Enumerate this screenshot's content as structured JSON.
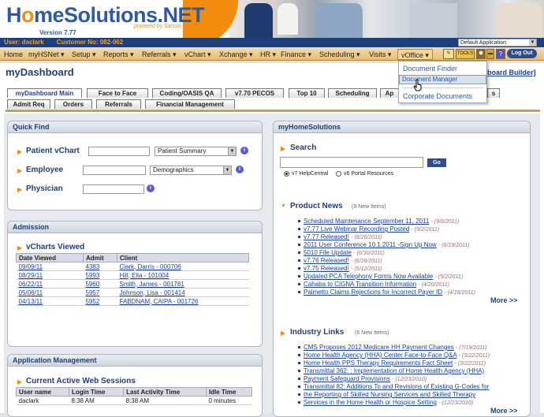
{
  "header": {
    "brand": "HomeSolutions.NET",
    "brand_left": "H",
    "brand_o": "o",
    "brand_rest": "meSolutions.NET",
    "version": "Version 7.77",
    "powered_by": "powered by Sansio"
  },
  "userbar": {
    "user": "User: daclark",
    "customer": "Customer No: 082-062"
  },
  "application": {
    "label": "Application",
    "value": "Default Application"
  },
  "nav": [
    "Home",
    "myHSNet ▾",
    "Setup ▾",
    "Reports ▾",
    "Referrals ▾",
    "vChart ▾",
    "Xchange ▾",
    "HR ▾",
    "Finance ▾",
    "Scheduling ▾",
    "Visits ▾",
    "vOffice ▾"
  ],
  "toolbar": {
    "tool1": "TOOLS",
    "logout": "Log Out",
    "help": "?"
  },
  "dropdown": {
    "items": [
      "Document Finder",
      "Document Manager",
      "Corporate Documents"
    ],
    "selected": 1
  },
  "page": {
    "title": "myDashboard",
    "builder": "board Builder]"
  },
  "tabs_row1": [
    "myDashboard Main",
    "Face to Face",
    "Coding/OASIS QA",
    "v7.70 PECOS",
    "Top 10",
    "Scheduling",
    "Ap",
    "s"
  ],
  "tabs_row2": [
    "Admit Req",
    "Orders",
    "Referrals",
    "Financial Management"
  ],
  "quick_find": {
    "title": "Quick Find",
    "patient_label": "Patient vChart",
    "patient_select": "Patient Summary",
    "employee_label": "Employee",
    "employee_select": "Demographics",
    "physician_label": "Physician"
  },
  "admission": {
    "title": "Admission",
    "subtitle": "vCharts Viewed",
    "columns": [
      "Date Viewed",
      "Admit",
      "Client"
    ],
    "rows": [
      [
        "09/09/11",
        "4383",
        "Clark, Darris - 000706"
      ],
      [
        "08/29/11",
        "5993",
        "Hill, Ella - 101004"
      ],
      [
        "06/22/11",
        "5960",
        "Smith, James - 001781"
      ],
      [
        "05/06/11",
        "5957",
        "Johnson, Lisa - 001414"
      ],
      [
        "04/13/11",
        "5952",
        "FABDNAM, CAIPA - 001726"
      ]
    ]
  },
  "app_mgmt": {
    "title": "Application Management",
    "subtitle": "Current Active Web Sessions",
    "columns": [
      "User name",
      "Login Time",
      "Last Activity Time",
      "Idle Time"
    ],
    "rows": [
      [
        "daclark",
        "8:38 AM",
        "8:38 AM",
        "0 minutes"
      ]
    ]
  },
  "my_home": {
    "title": "myHomeSolutions",
    "search_label": "Search",
    "go": "Go",
    "radio1": "v7 HelpCentral",
    "radio2": "v6 Portal Resources"
  },
  "product_news": {
    "title": "Product News",
    "badge": "(9 New Items)",
    "items": [
      {
        "t": "Scheduled Maintenance September 11, 2011",
        "d": "- (9/8/2011)"
      },
      {
        "t": "v7.77 Live Webinar Recording Posted",
        "d": "- (9/2/2011)"
      },
      {
        "t": "v7.77 Released!",
        "d": "- (8/26/2011)"
      },
      {
        "t": "2011 User Conference 10.1.2011 -Sign Up Now",
        "d": "- (8/19/2011)"
      },
      {
        "t": "5010 File Update",
        "d": "- (6/30/2011)"
      },
      {
        "t": "v7.76 Released!",
        "d": "- (6/28/2011)"
      },
      {
        "t": "v7.75 Released!",
        "d": "- (5/12/2011)"
      },
      {
        "t": "Updated PCA Telephony Forms Now Available",
        "d": "- (5/2/2011)"
      },
      {
        "t": "Cahaba to CIGNA Transition Information",
        "d": "- (4/20/2011)"
      },
      {
        "t": "Palmetto Claims Rejections for Incorrect Payer ID",
        "d": "- (4/18/2011)"
      }
    ],
    "more": "More >>"
  },
  "industry_links": {
    "title": "Industry Links",
    "badge": "(6 New Items)",
    "items": [
      {
        "t": "CMS Proposes 2012 Medicare HH Payment Changes",
        "d": "- (7/19/2011)"
      },
      {
        "t": "Home Health Agency (HHA) Center Face-to-Face Q&A",
        "d": "- (3/22/2011)"
      },
      {
        "t": "Home Health PPS Therapy Requirements Fact Sheet",
        "d": "- (3/22/2011)"
      },
      {
        "t": "Transmittal 362: : Implementation of Home Health Agency (HHA)",
        "d": ""
      },
      {
        "t": "Payment Safeguard Provisions",
        "d": "- (12/23/2010)"
      },
      {
        "t": "Transmittal 82: Additions To and Revisions of Existing G-Codes for",
        "d": ""
      },
      {
        "t": "the Reporting of Skilled Nursing Services and Skilled Therapy",
        "d": ""
      },
      {
        "t": "Services in the Home Health or Hospice Setting",
        "d": "- (12/23/2010)"
      }
    ],
    "more": "More >>"
  },
  "colors": {
    "accent": "#f28c0f",
    "brand": "#2d5aa8",
    "nav_bg": "#e8bf72",
    "header_dark": "#1f3f7a"
  }
}
